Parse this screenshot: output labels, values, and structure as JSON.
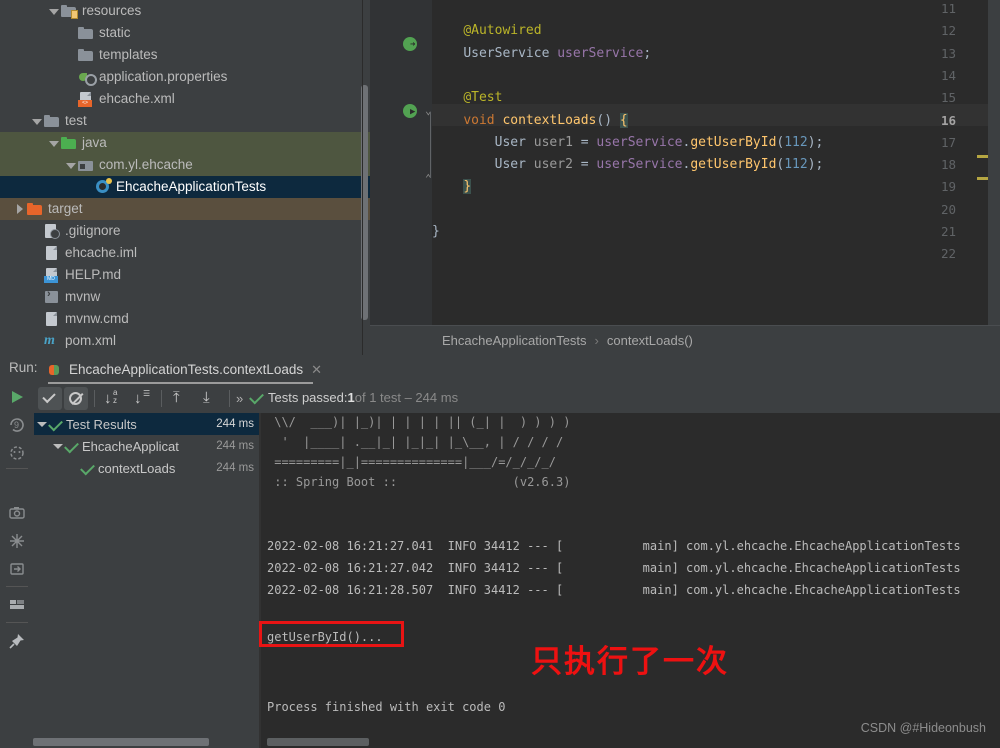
{
  "project_tree": {
    "rows": [
      {
        "indent": 2,
        "arrow": "down",
        "icon": "folder-resources",
        "label": "resources",
        "state": "none"
      },
      {
        "indent": 3,
        "arrow": "none",
        "icon": "folder",
        "label": "static",
        "state": "none"
      },
      {
        "indent": 3,
        "arrow": "none",
        "icon": "folder",
        "label": "templates",
        "state": "none"
      },
      {
        "indent": 3,
        "arrow": "none",
        "icon": "properties-file",
        "label": "application.properties",
        "state": "none"
      },
      {
        "indent": 3,
        "arrow": "none",
        "icon": "xml-file",
        "label": "ehcache.xml",
        "state": "none"
      },
      {
        "indent": 1,
        "arrow": "down",
        "icon": "folder",
        "label": "test",
        "state": "none"
      },
      {
        "indent": 2,
        "arrow": "down",
        "icon": "folder-source",
        "label": "java",
        "state": "green"
      },
      {
        "indent": 3,
        "arrow": "down",
        "icon": "package",
        "label": "com.yl.ehcache",
        "state": "green"
      },
      {
        "indent": 4,
        "arrow": "none",
        "icon": "test-class",
        "label": "EhcacheApplicationTests",
        "state": "selected"
      },
      {
        "indent": 0,
        "arrow": "right",
        "icon": "folder-target",
        "label": "target",
        "state": "brown"
      },
      {
        "indent": 1,
        "arrow": "none",
        "icon": "gitignore-file",
        "label": ".gitignore",
        "state": "none"
      },
      {
        "indent": 1,
        "arrow": "none",
        "icon": "iml-file",
        "label": "ehcache.iml",
        "state": "none"
      },
      {
        "indent": 1,
        "arrow": "none",
        "icon": "md-file",
        "label": "HELP.md",
        "state": "none"
      },
      {
        "indent": 1,
        "arrow": "none",
        "icon": "script-file",
        "label": "mvnw",
        "state": "none"
      },
      {
        "indent": 1,
        "arrow": "none",
        "icon": "cmd-file",
        "label": "mvnw.cmd",
        "state": "none"
      },
      {
        "indent": 1,
        "arrow": "none",
        "icon": "maven-file",
        "label": "pom.xml",
        "state": "none"
      }
    ]
  },
  "editor": {
    "lines": [
      {
        "num": "11",
        "text": ""
      },
      {
        "num": "12",
        "text": "    @Autowired"
      },
      {
        "num": "13",
        "text": "    UserService userService;"
      },
      {
        "num": "14",
        "text": ""
      },
      {
        "num": "15",
        "text": "    @Test"
      },
      {
        "num": "16",
        "text": "    void contextLoads() {"
      },
      {
        "num": "17",
        "text": "        User user1 = userService.getUserById(112);"
      },
      {
        "num": "18",
        "text": "        User user2 = userService.getUserById(112);"
      },
      {
        "num": "19",
        "text": "    }"
      },
      {
        "num": "20",
        "text": ""
      },
      {
        "num": "21",
        "text": "}"
      },
      {
        "num": "22",
        "text": ""
      }
    ],
    "breadcrumb": {
      "class": "EhcacheApplicationTests",
      "separator": "›",
      "method": "contextLoads()"
    }
  },
  "run_panel": {
    "run_label": "Run:",
    "tab_title": "EhcacheApplicationTests.contextLoads",
    "tab_close": "✕",
    "toolbar": {
      "rerun_tooltip": "Rerun",
      "show_passed": "✓",
      "show_ignored": "⊘",
      "sort_alpha": "↓ᵃz",
      "sort_duration": "↓",
      "expand_all": "⇥",
      "collapse_all": "⇤",
      "more": "»"
    },
    "status": {
      "prefix": "Tests passed: ",
      "count": "1",
      "suffix": " of 1 test – 244 ms"
    },
    "tests": [
      {
        "indent": 0,
        "label": "Test Results",
        "time": "244 ms",
        "expanded": true,
        "selected": true
      },
      {
        "indent": 1,
        "label": "EhcacheApplicat",
        "time": "244 ms",
        "expanded": true,
        "selected": false
      },
      {
        "indent": 2,
        "label": "contextLoads",
        "time": "244 ms",
        "expanded": false,
        "selected": false
      }
    ]
  },
  "console": {
    "banner": [
      " \\\\/  ___)| |_)| | | | | || (_| |  ) ) ) )",
      "  '  |____| .__|_| |_|_| |_\\__, | / / / /",
      " =========|_|==============|___/=/_/_/_/",
      " :: Spring Boot ::                (v2.6.3)"
    ],
    "logs": [
      "2022-02-08 16:21:27.041  INFO 34412 --- [           main] com.yl.ehcache.EhcacheApplicationTests",
      "2022-02-08 16:21:27.042  INFO 34412 --- [           main] com.yl.ehcache.EhcacheApplicationTests",
      "2022-02-08 16:21:28.507  INFO 34412 --- [           main] com.yl.ehcache.EhcacheApplicationTests"
    ],
    "highlighted_output": "getUserById()...",
    "exit_line": "Process finished with exit code 0",
    "annotation": "只执行了一次",
    "annotation_color": "#ee1111",
    "box_color": "#e81414"
  },
  "watermark": "CSDN @#Hideonbush"
}
